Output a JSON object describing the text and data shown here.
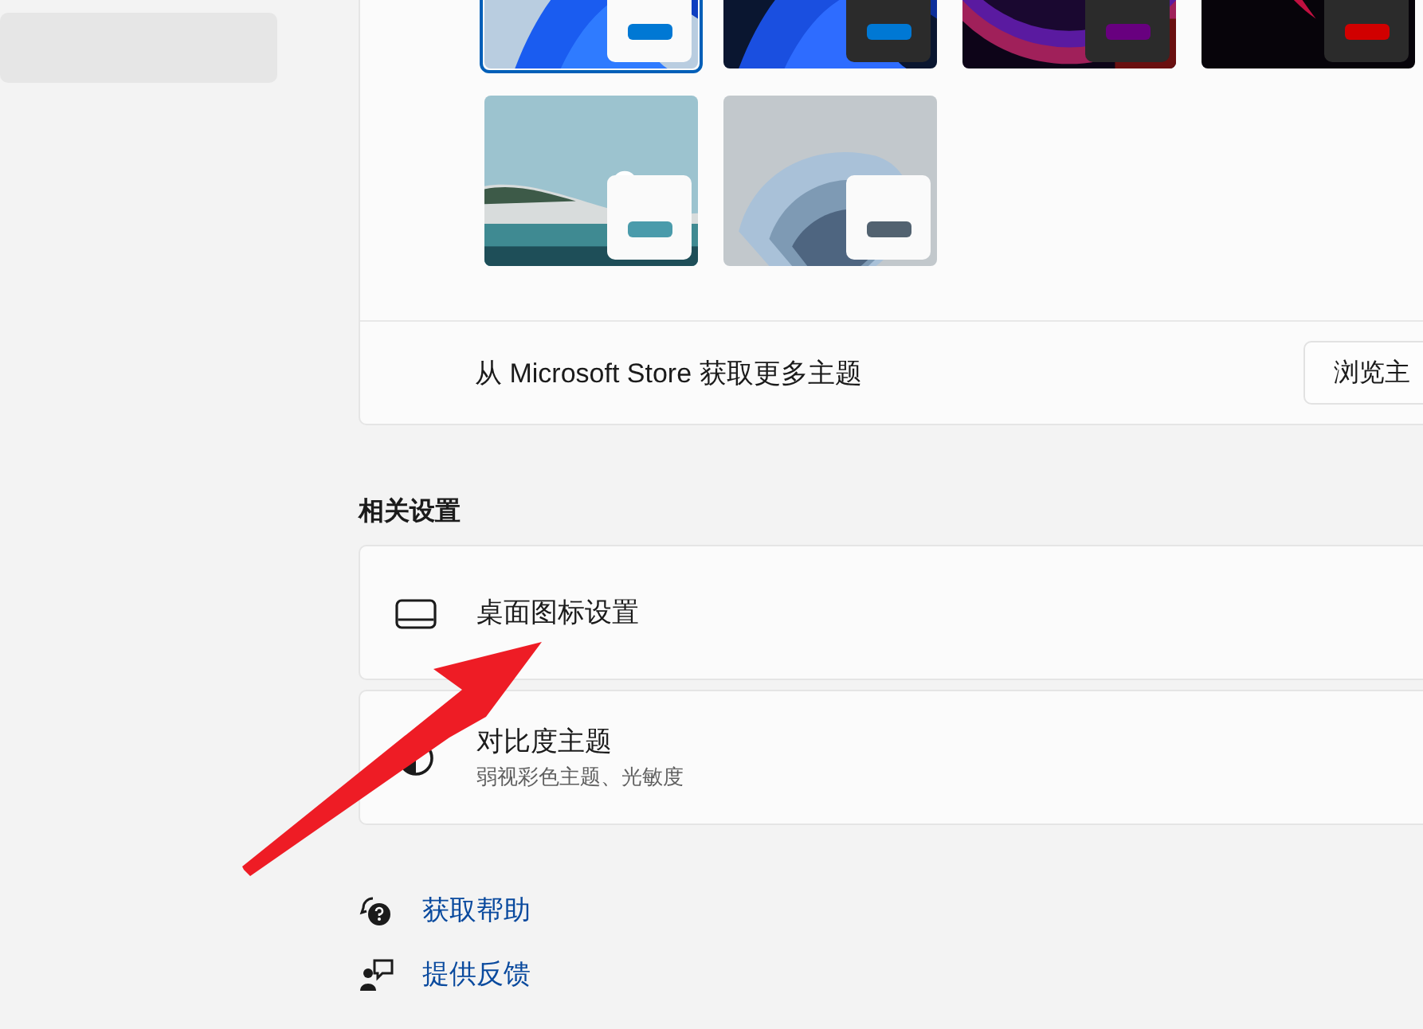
{
  "sidebar": {
    "items": [
      {
        "selected": true
      }
    ]
  },
  "themes": {
    "items": [
      {
        "kind": "picture",
        "dark": false,
        "color": "#0078d4",
        "selected": true
      },
      {
        "kind": "picture",
        "dark": true,
        "color": "#0078d4",
        "selected": false
      },
      {
        "kind": "picture",
        "dark": true,
        "color": "#68007f",
        "selected": false
      },
      {
        "kind": "picture",
        "dark": true,
        "color": "#d10000",
        "selected": false
      },
      {
        "kind": "picture",
        "dark": false,
        "color": "#4a9bab",
        "selected": false
      },
      {
        "kind": "picture",
        "dark": false,
        "color": "#526270",
        "selected": false
      }
    ],
    "store_text": "从 Microsoft Store 获取更多主题",
    "store_button": "浏览主"
  },
  "related_settings": {
    "heading": "相关设置",
    "items": [
      {
        "kind": "desktop-icons",
        "title": "桌面图标设置"
      },
      {
        "kind": "contrast",
        "title": "对比度主题",
        "subtitle": "弱视彩色主题、光敏度"
      }
    ]
  },
  "links": [
    {
      "kind": "help",
      "label": "获取帮助"
    },
    {
      "kind": "feedback",
      "label": "提供反馈"
    }
  ]
}
